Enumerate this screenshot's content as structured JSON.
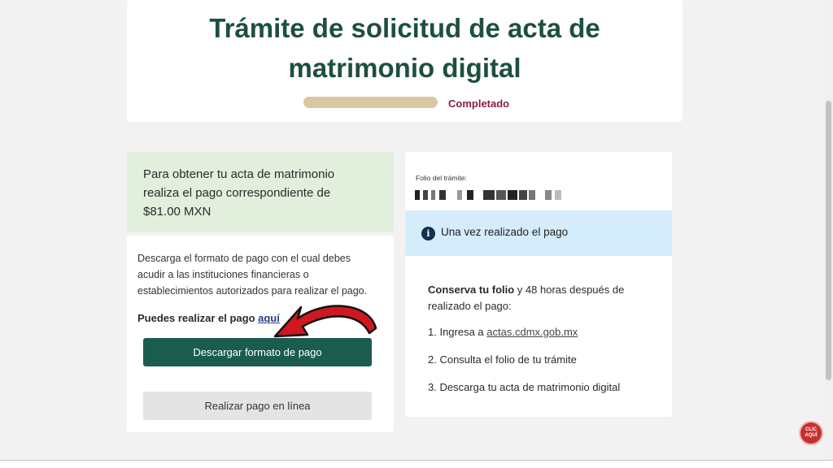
{
  "header": {
    "title_line1": "Trámite de solicitud de acta de",
    "title_line2": "matrimonio digital",
    "progress": {
      "value": 1.0,
      "status": "Completado"
    }
  },
  "notice": {
    "line1": "Para obtener tu acta de matrimonio",
    "line2": "realiza el pago correspondiente de",
    "line3": "$81.00 MXN"
  },
  "payment": {
    "desc_line1": "Descarga el formato de pago con el cual debes",
    "desc_line2": "acudir a las instituciones financieras o",
    "desc_line3": "establecimientos autorizados para realizar el pago.",
    "pay_here_prefix": "Puedes realizar el pago ",
    "pay_here_link": "aquí",
    "download_button": "Descargar formato de pago",
    "online_button": "Realizar pago en línea"
  },
  "folio": {
    "label": "Folio del trámite:",
    "alert_text": "Una vez realizado el pago",
    "keep_bold": "Conserva tu folio",
    "keep_rest": " y 48 horas después de realizado el pago:",
    "step1_prefix": "1. Ingresa a ",
    "step1_link": "actas.cdmx.gob.mx",
    "step2": "2. Consulta el folio de tu trámite",
    "step3": "3. Descarga tu acta de matrimonio digital"
  },
  "badge": {
    "line1": "CLIC",
    "line2": "AQUÍ"
  },
  "colors": {
    "title": "#1e4f3f",
    "status": "#8b1e3f",
    "primary_button": "#1b5c51",
    "notice_bg": "#e1efdc",
    "alert_bg": "#d5ecfb",
    "arrow": "#d0181e"
  },
  "icons": [
    "info-icon",
    "arrow-annotation",
    "clic-aqui-badge"
  ]
}
